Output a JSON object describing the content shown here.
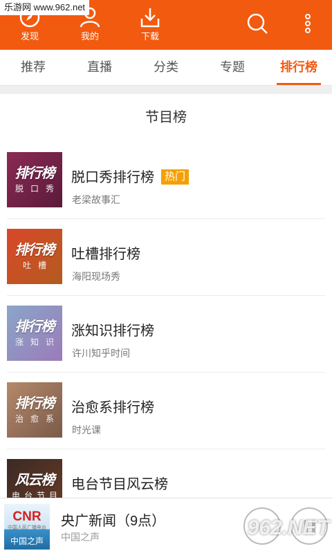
{
  "watermark": "乐游网 www.962.net",
  "topbar": {
    "items": [
      {
        "label": "发现",
        "icon": "compass-icon"
      },
      {
        "label": "我的",
        "icon": "user-icon"
      },
      {
        "label": "下载",
        "icon": "download-icon"
      }
    ],
    "search_icon": "search-icon",
    "menu_icon": "more-vertical-icon",
    "color": "#f25a0f"
  },
  "tabs": [
    {
      "label": "推荐"
    },
    {
      "label": "直播"
    },
    {
      "label": "分类"
    },
    {
      "label": "专题"
    },
    {
      "label": "排行榜",
      "active": true
    }
  ],
  "section": {
    "title": "节目榜"
  },
  "rankings": [
    {
      "logo": "排行榜",
      "tag": "脱口秀",
      "title": "脱口秀排行榜",
      "badge": "热门",
      "subtitle": "老梁故事汇",
      "colors": [
        "#8a2a55",
        "#5b1a3a"
      ]
    },
    {
      "logo": "排行榜",
      "tag": "吐槽",
      "title": "吐槽排行榜",
      "subtitle": "海阳现场秀",
      "colors": [
        "#d9482b",
        "#b35b1e"
      ]
    },
    {
      "logo": "排行榜",
      "tag": "涨知识",
      "title": "涨知识排行榜",
      "subtitle": "许川知乎时间",
      "colors": [
        "#8aa6c9",
        "#9b7bb8"
      ]
    },
    {
      "logo": "排行榜",
      "tag": "治愈系",
      "title": "治愈系排行榜",
      "subtitle": "时光课",
      "colors": [
        "#b5896a",
        "#7a5a4a"
      ]
    },
    {
      "logo": "风云榜",
      "tag": "电台节目",
      "title": "电台节目风云榜",
      "subtitle": "",
      "colors": [
        "#3a2a25",
        "#6a3a25"
      ]
    }
  ],
  "player": {
    "logo_text": "CNR",
    "logo_sub": "中国人民广播电台",
    "logo_name": "中国之声",
    "title": "央广新闻（9点）",
    "subtitle": "中国之声",
    "site_watermark": "962.NET"
  }
}
